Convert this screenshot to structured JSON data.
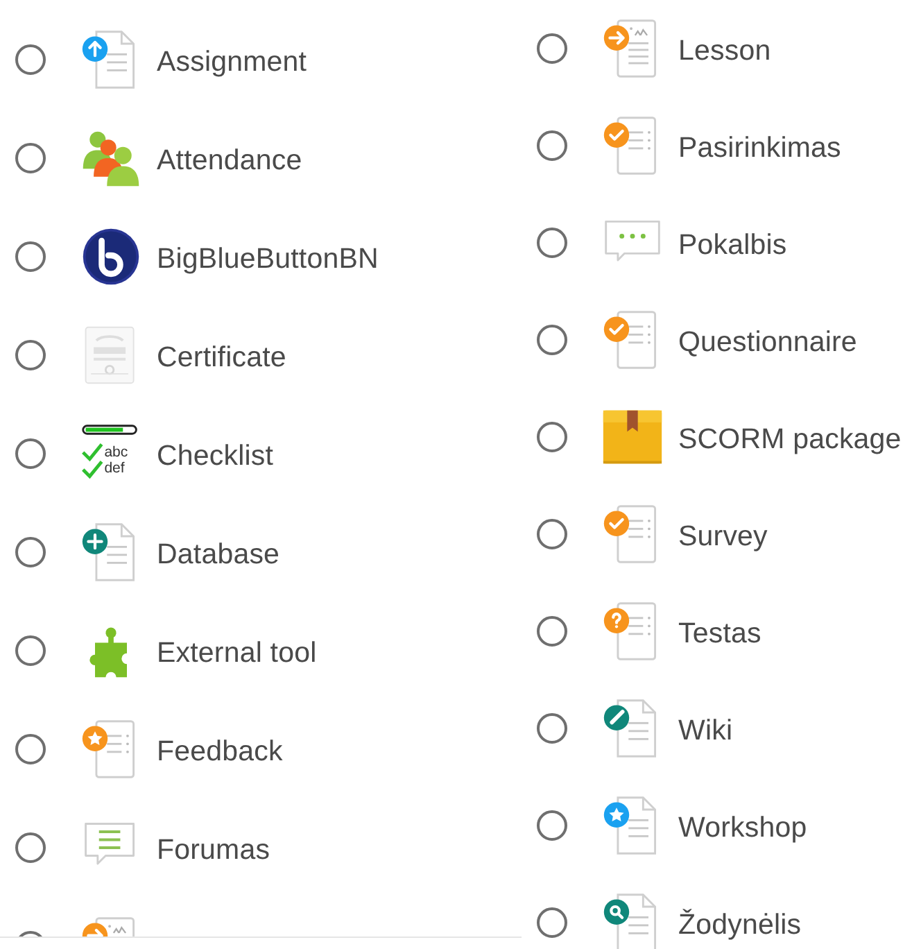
{
  "columns": [
    {
      "items": [
        {
          "kind": "assignment",
          "label": "Assignment",
          "selected": false
        },
        {
          "kind": "attendance",
          "label": "Attendance",
          "selected": false
        },
        {
          "kind": "bigbluebutton",
          "label": "BigBlueButtonBN",
          "selected": false
        },
        {
          "kind": "certificate",
          "label": "Certificate",
          "selected": false
        },
        {
          "kind": "checklist",
          "label": "Checklist",
          "selected": false,
          "icon_text": [
            "abc",
            "def"
          ]
        },
        {
          "kind": "database",
          "label": "Database",
          "selected": false
        },
        {
          "kind": "external",
          "label": "External tool",
          "selected": false
        },
        {
          "kind": "feedback",
          "label": "Feedback",
          "selected": false
        },
        {
          "kind": "forum",
          "label": "Forumas",
          "selected": false
        },
        {
          "kind": "lesson",
          "selected": false
        }
      ]
    },
    {
      "items": [
        {
          "kind": "lesson",
          "label": "Lesson",
          "selected": false
        },
        {
          "kind": "choice",
          "label": "Pasirinkimas",
          "selected": false
        },
        {
          "kind": "chat",
          "label": "Pokalbis",
          "selected": false
        },
        {
          "kind": "questionnaire",
          "label": "Questionnaire",
          "selected": false
        },
        {
          "kind": "scorm",
          "label": "SCORM package",
          "selected": false
        },
        {
          "kind": "survey",
          "label": "Survey",
          "selected": false
        },
        {
          "kind": "quiz",
          "label": "Testas",
          "selected": false
        },
        {
          "kind": "wiki",
          "label": "Wiki",
          "selected": false
        },
        {
          "kind": "workshop",
          "label": "Workshop",
          "selected": false
        },
        {
          "kind": "glossary",
          "label": "Žodynėlis",
          "selected": false
        }
      ]
    }
  ]
}
